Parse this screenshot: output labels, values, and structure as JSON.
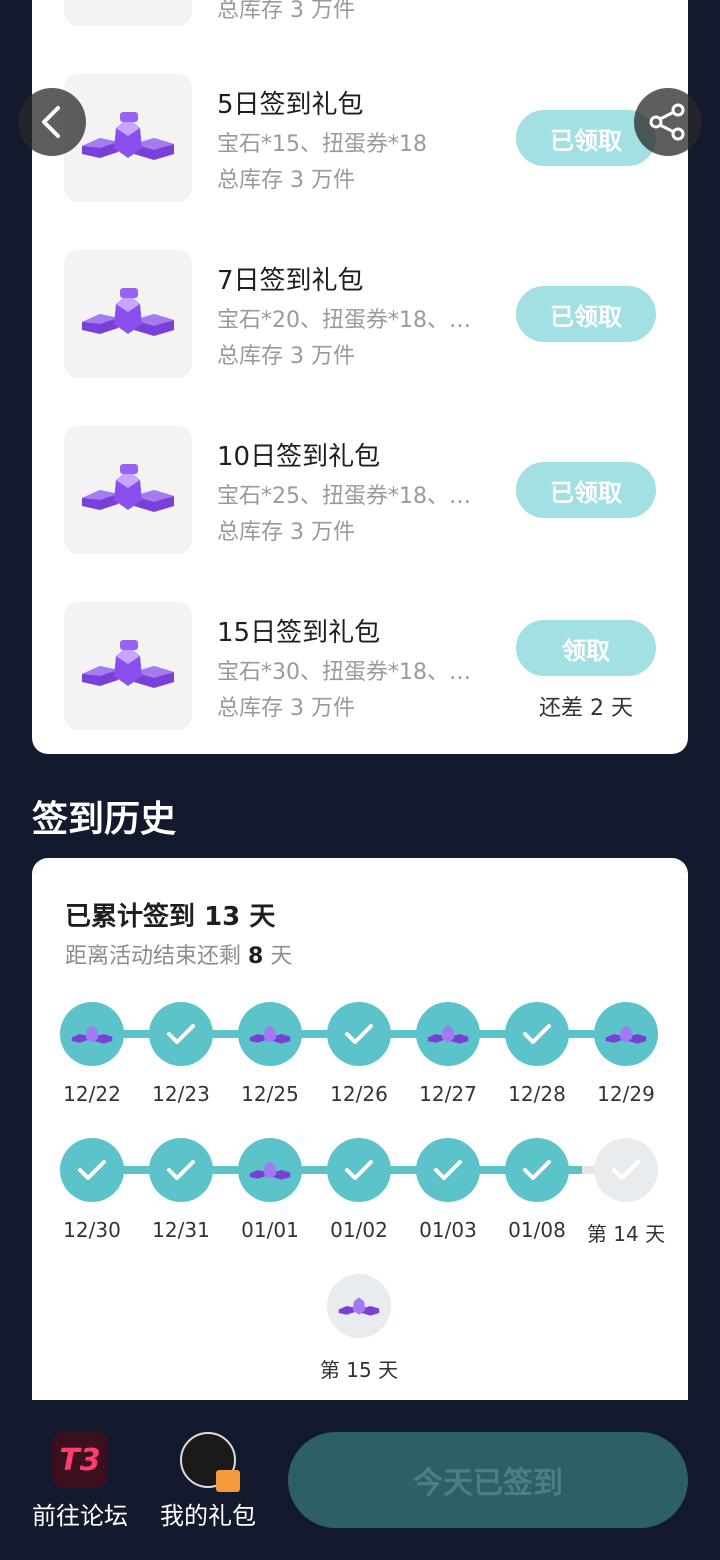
{
  "top_peek": {
    "stock": "总库存 3 万件"
  },
  "rewards": [
    {
      "title": "5日签到礼包",
      "desc": "宝石*15、扭蛋券*18",
      "stock": "总库存 3 万件",
      "button": "已领取",
      "note": ""
    },
    {
      "title": "7日签到礼包",
      "desc": "宝石*20、扭蛋券*18、…",
      "stock": "总库存 3 万件",
      "button": "已领取",
      "note": ""
    },
    {
      "title": "10日签到礼包",
      "desc": "宝石*25、扭蛋券*18、…",
      "stock": "总库存 3 万件",
      "button": "已领取",
      "note": ""
    },
    {
      "title": "15日签到礼包",
      "desc": "宝石*30、扭蛋券*18、…",
      "stock": "总库存 3 万件",
      "button": "领取",
      "note": "还差 2 天"
    }
  ],
  "history": {
    "title": "签到历史",
    "total_prefix": "已累计签到",
    "total_days": "13",
    "total_suffix": "天",
    "remain_prefix": "距离活动结束还剩",
    "remain_days": "8",
    "remain_suffix": "天",
    "row1": [
      {
        "date": "12/22",
        "type": "gift"
      },
      {
        "date": "12/23",
        "type": "check"
      },
      {
        "date": "12/25",
        "type": "gift"
      },
      {
        "date": "12/26",
        "type": "check"
      },
      {
        "date": "12/27",
        "type": "gift"
      },
      {
        "date": "12/28",
        "type": "check"
      },
      {
        "date": "12/29",
        "type": "gift"
      }
    ],
    "row2": [
      {
        "date": "12/30",
        "type": "check"
      },
      {
        "date": "12/31",
        "type": "check"
      },
      {
        "date": "01/01",
        "type": "gift"
      },
      {
        "date": "01/02",
        "type": "check"
      },
      {
        "date": "01/03",
        "type": "check"
      },
      {
        "date": "01/08",
        "type": "check"
      },
      {
        "date": "第 14 天",
        "type": "future-check"
      }
    ],
    "row3": [
      {
        "date": "第 15 天",
        "type": "future-gift"
      }
    ]
  },
  "bottom_bar": {
    "forum_label": "前往论坛",
    "forum_logo": "T3",
    "gifts_label": "我的礼包",
    "signed_label": "今天已签到"
  },
  "colors": {
    "accent": "#5bc3c9",
    "claimed_button": "#a3e0e3",
    "background": "#131a2e"
  }
}
